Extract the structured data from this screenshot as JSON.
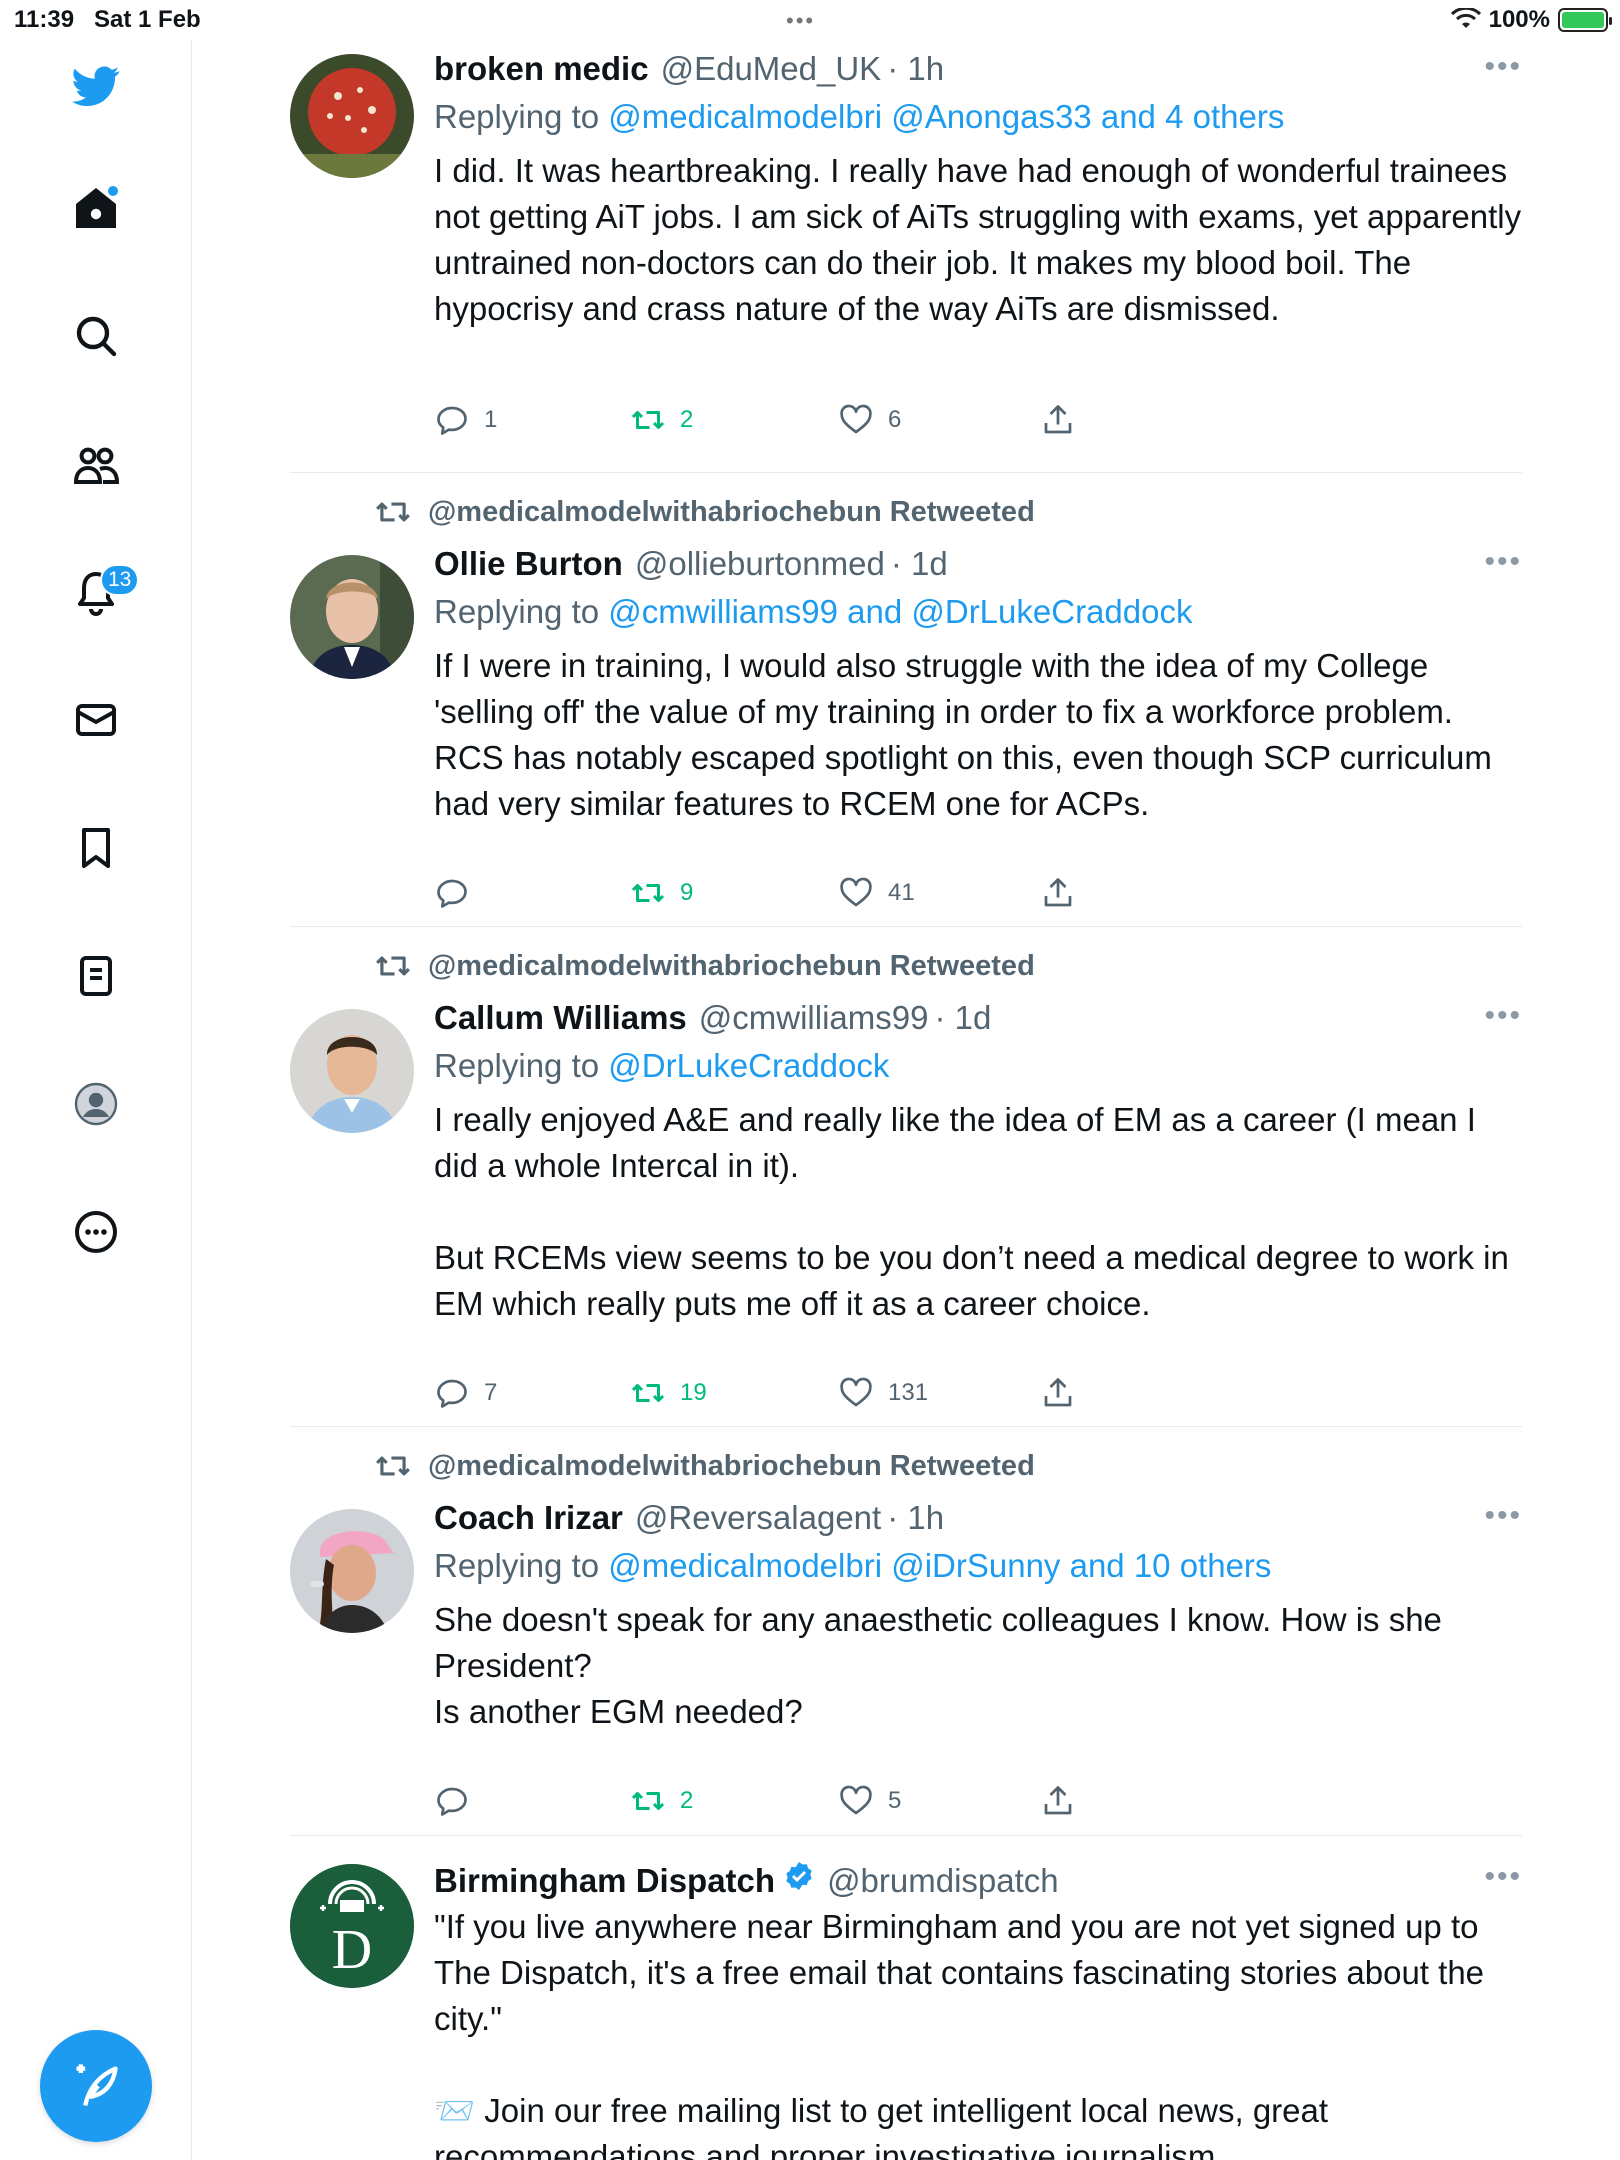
{
  "status_bar": {
    "time": "11:39",
    "date": "Sat 1 Feb",
    "battery": "100%",
    "multitask_dots": "•••"
  },
  "sidebar": {
    "notification_count": "13"
  },
  "tweets": [
    {
      "retweeted_by": "",
      "name": "broken medic",
      "handle": "@EduMed_UK",
      "time": "· 1h",
      "replying_prefix": "Replying to ",
      "replying_to": "@medicalmodelbri @Anongas33 and 4 others",
      "text": "I did. It was heartbreaking. I really have had enough of wonderful trainees not getting AiT jobs. I am sick of AiTs struggling with exams, yet apparently untrained non-doctors can do their job. It makes my blood boil. The hypocrisy and crass nature of the way AiTs are dismissed.",
      "replies": "1",
      "retweets": "2",
      "likes": "6",
      "retweet_active": true
    },
    {
      "retweeted_by": "@medicalmodelwithabriochebun Retweeted",
      "name": "Ollie Burton",
      "handle": "@ollieburtonmed",
      "time": "· 1d",
      "replying_prefix": "Replying to ",
      "replying_to": "@cmwilliams99 and @DrLukeCraddock",
      "text": "If I were in training, I would also struggle with the idea of my College 'selling off' the value of my training in order to fix a workforce problem. RCS has notably escaped spotlight on this, even though SCP curriculum had very similar features to RCEM one for ACPs.",
      "replies": "",
      "retweets": "9",
      "likes": "41",
      "retweet_active": true
    },
    {
      "retweeted_by": "@medicalmodelwithabriochebun Retweeted",
      "name": "Callum Williams",
      "handle": "@cmwilliams99",
      "time": "· 1d",
      "replying_prefix": "Replying to ",
      "replying_to": "@DrLukeCraddock",
      "text": "I really enjoyed A&E and really like the idea of EM as a career (I mean I did a whole Intercal in it).\n\nBut RCEMs view seems to be you don’t need a medical degree to work in EM which really puts me off it as a career choice.",
      "replies": "7",
      "retweets": "19",
      "likes": "131",
      "retweet_active": true
    },
    {
      "retweeted_by": "@medicalmodelwithabriochebun Retweeted",
      "name": "Coach Irizar",
      "handle": "@Reversalagent",
      "time": "· 1h",
      "replying_prefix": "Replying to ",
      "replying_to": "@medicalmodelbri @iDrSunny and 10 others",
      "text": "She doesn't speak for any anaesthetic colleagues I know. How is she President?\nIs another EGM needed?",
      "replies": "",
      "retweets": "2",
      "likes": "5",
      "retweet_active": true
    },
    {
      "retweeted_by": "",
      "name": "Birmingham Dispatch",
      "handle": "@brumdispatch",
      "time": "",
      "verified": true,
      "text": "\"If you live anywhere near Birmingham and you are not yet signed up to The Dispatch, it's a free email that contains fascinating stories about the city.\"\n\n📨 Join our free mailing list to get intelligent local news, great recommendations and proper investigative journalism",
      "avatar_letter": "D"
    }
  ],
  "colors": {
    "accent": "#1d9bf0",
    "retweet_green": "#00ba7c",
    "secondary_text": "#536471",
    "dispatch_green": "#1b5e3b"
  }
}
